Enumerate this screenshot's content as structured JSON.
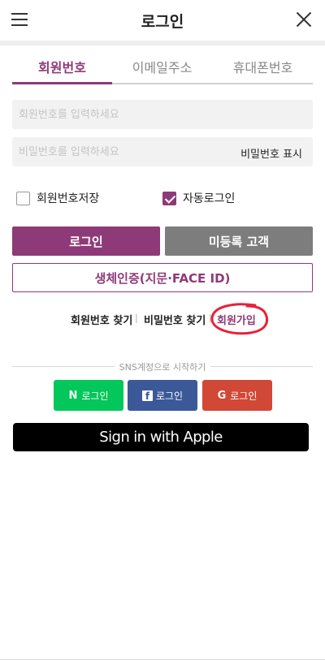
{
  "header": {
    "title": "로그인"
  },
  "tabs": [
    {
      "label": "회원번호"
    },
    {
      "label": "이메일주소"
    },
    {
      "label": "휴대폰번호"
    }
  ],
  "form": {
    "member_placeholder": "회원번호를 입력하세요",
    "password_placeholder": "비밀번호를 입력하세요",
    "show_password": "비밀번호 표시"
  },
  "options": {
    "save_member_no": {
      "label": "회원번호저장",
      "checked": false
    },
    "auto_login": {
      "label": "자동로그인",
      "checked": true
    }
  },
  "buttons": {
    "login": "로그인",
    "guest": "미등록 고객",
    "biometric": "생체인증(지문·FACE ID)"
  },
  "links": {
    "find_id": "회원번호 찾기",
    "separator": "|",
    "find_password": "비밀번호 찾기",
    "join": "회원가입"
  },
  "sns": {
    "title": "SNS계정으로 시작하기",
    "naver": {
      "icon": "N",
      "label": "로그인"
    },
    "facebook": {
      "icon": "f",
      "label": "로그인"
    },
    "google": {
      "icon": "G",
      "label": "로그인"
    },
    "apple": "Sign in with Apple"
  },
  "colors": {
    "brand": "#8e3a78",
    "guest": "#7d7d7d",
    "naver": "#03c75a",
    "facebook": "#3b5998",
    "google": "#d14836",
    "annotation": "#e8213a"
  }
}
